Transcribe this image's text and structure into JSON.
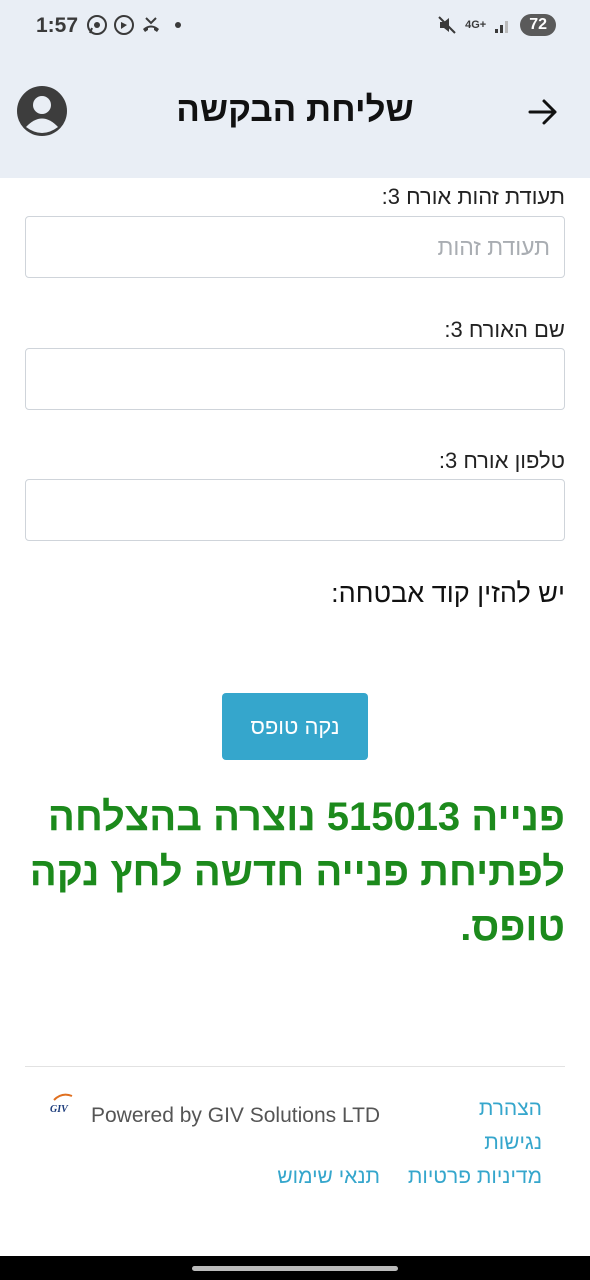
{
  "status_bar": {
    "time": "1:57",
    "network": "4G+",
    "battery": "72"
  },
  "header": {
    "title": "שליחת הבקשה"
  },
  "form": {
    "guest3_id_label": "תעודת זהות אורח 3:",
    "guest3_id_placeholder": "תעודת זהות",
    "guest3_id_value": "",
    "guest3_name_label": "שם האורח 3:",
    "guest3_name_value": "",
    "guest3_phone_label": "טלפון אורח 3:",
    "guest3_phone_value": "",
    "security_note": "יש להזין קוד אבטחה:"
  },
  "clear_button_label": "נקה טופס",
  "success_message": "פנייה 515013 נוצרה בהצלחה לפתיחת פנייה חדשה לחץ נקה טופס.",
  "footer": {
    "powered_by": "Powered by GIV Solutions LTD",
    "links": {
      "accessibility": "הצהרת נגישות",
      "privacy": "מדיניות פרטיות",
      "terms": "תנאי שימוש"
    }
  },
  "colors": {
    "header_bg": "#e9eef5",
    "accent": "#35a6cc",
    "success": "#1c8a1c"
  },
  "icons": {
    "back": "arrow-right-icon",
    "profile": "user-avatar-icon"
  }
}
